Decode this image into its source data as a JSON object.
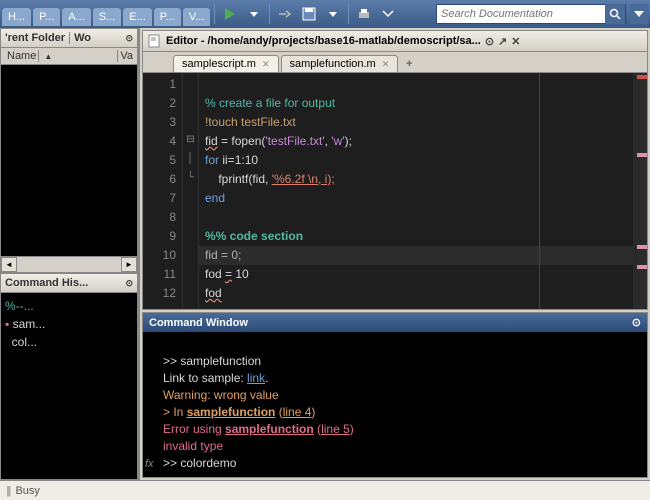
{
  "toolbar": {
    "tabs": [
      "H...",
      "P...",
      "A...",
      "S...",
      "E...",
      "P...",
      "V..."
    ],
    "search_placeholder": "Search Documentation"
  },
  "folder": {
    "title": "'rent Folder",
    "workspace_tab": "Wo",
    "col_name": "Name",
    "col_value": "Va"
  },
  "history": {
    "title": "Command His...",
    "items": [
      "%--...",
      "sam...",
      "col..."
    ]
  },
  "editor": {
    "title": "Editor - /home/andy/projects/base16-matlab/demoscript/sa...",
    "tabs": [
      {
        "label": "samplescript.m",
        "active": true
      },
      {
        "label": "samplefunction.m",
        "active": false
      }
    ],
    "lines": [
      "1",
      "2",
      "3",
      "4",
      "5",
      "6",
      "7",
      "8",
      "9",
      "10",
      "11",
      "12"
    ],
    "code": {
      "l1_comment": "% create a file for output",
      "l2_bang": "!touch testFile.txt",
      "l3_a": "fid",
      "l3_b": " = fopen(",
      "l3_c": "'testFile.txt'",
      "l3_d": ", ",
      "l3_e": "'w'",
      "l3_f": ");",
      "l4_a": "for",
      "l4_b": " ii=1:10",
      "l5_a": "    fprintf(fid, ",
      "l5_b": "'%6.2f \\n, i);",
      "l6": "end",
      "l8": "%% code section",
      "l9": "fid = 0;",
      "l10_a": "fod ",
      "l10_b": "=",
      "l10_c": " 10",
      "l11": "fod"
    }
  },
  "cmd": {
    "title": "Command Window",
    "l1": ">> samplefunction",
    "l2_a": "Link to sample: ",
    "l2_b": "link",
    "l2_c": ".",
    "l3": "Warning: wrong value",
    "l4_a": "> In ",
    "l4_b": "samplefunction",
    "l4_c": " (",
    "l4_d": "line 4",
    "l4_e": ")",
    "l5_a": "Error using ",
    "l5_b": "samplefunction",
    "l5_c": " (",
    "l5_d": "line 5",
    "l5_e": ")",
    "l6": "invalid type",
    "l7": ">> colordemo"
  },
  "status": {
    "text": "Busy"
  }
}
